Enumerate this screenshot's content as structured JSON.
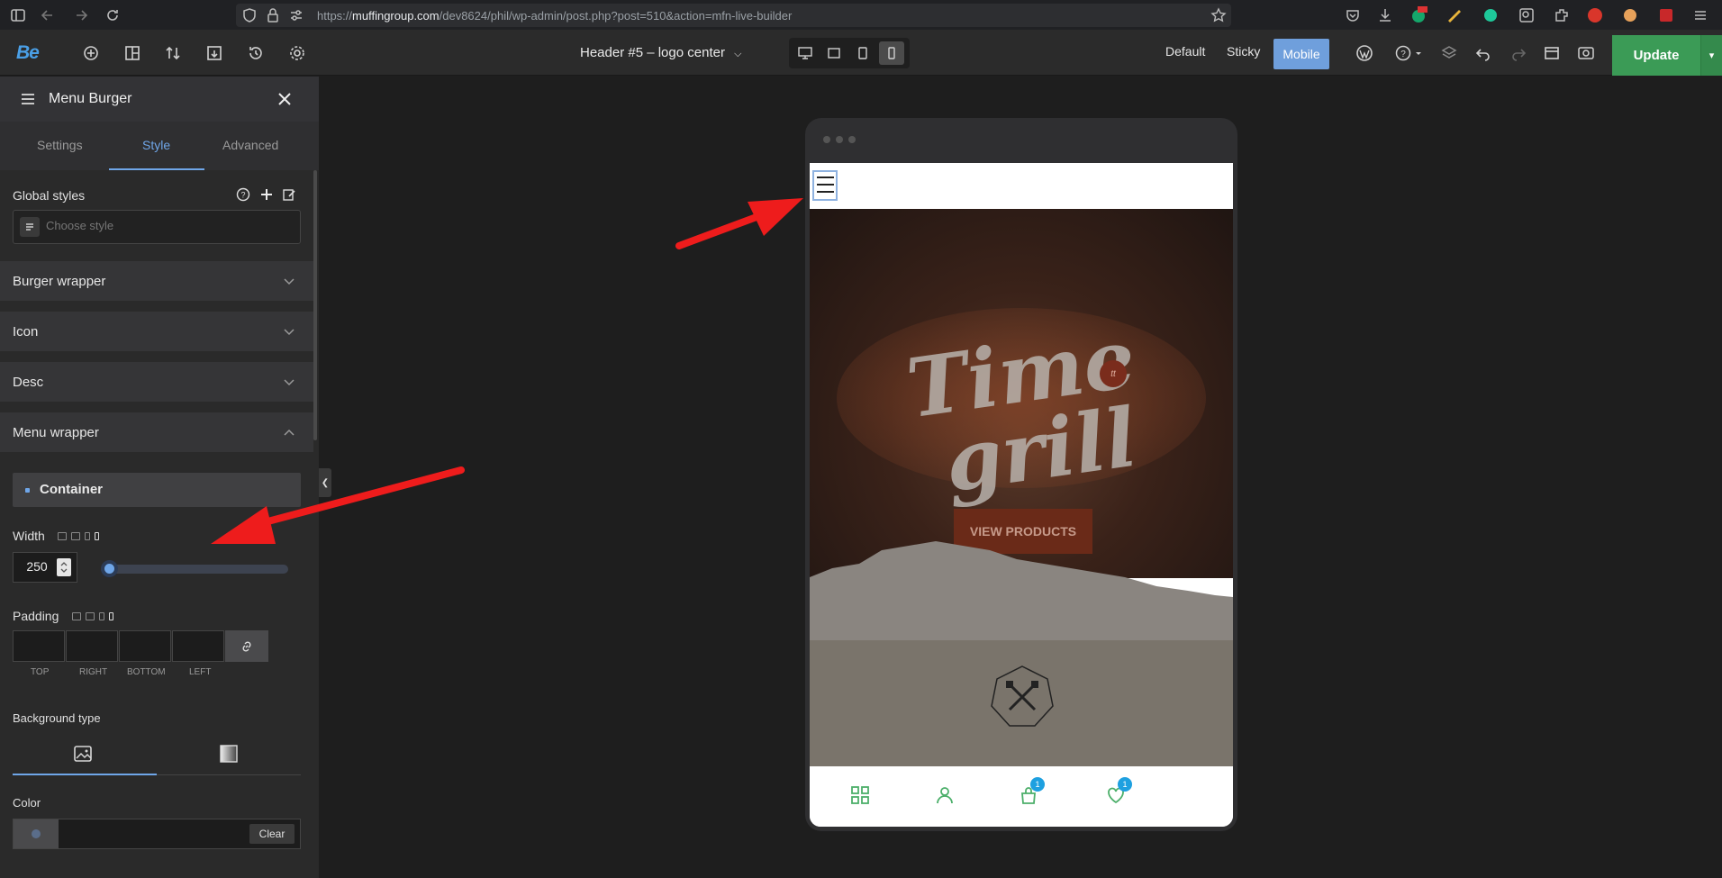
{
  "browser": {
    "url_prefix": "https://",
    "url_host": "muffingroup.com",
    "url_path": "/dev8624/phil/wp-admin/post.php?post=510&action=mfn-live-builder"
  },
  "toolbar": {
    "logo": "Be",
    "page_title": "Header #5 – logo center",
    "modes": {
      "default": "Default",
      "sticky": "Sticky",
      "mobile": "Mobile"
    },
    "update_label": "Update"
  },
  "panel": {
    "title": "Menu Burger",
    "tabs": [
      "Settings",
      "Style",
      "Advanced"
    ],
    "active_tab": "Style",
    "global_styles_label": "Global styles",
    "style_placeholder": "Choose style",
    "sections": [
      "Burger wrapper",
      "Icon",
      "Desc",
      "Menu wrapper"
    ],
    "container_label": "Container",
    "width_label": "Width",
    "width_value": "250",
    "width_slider_fraction": 0.0,
    "padding_label": "Padding",
    "padding_sides": [
      "TOP",
      "RIGHT",
      "BOTTOM",
      "LEFT"
    ],
    "background_type_label": "Background type",
    "color_label": "Color",
    "clear_label": "Clear"
  },
  "preview": {
    "hero_logo_line1": "Time",
    "hero_logo_line2": "grill",
    "hero_button": "VIEW PRODUCTS",
    "cart_count": "1",
    "wishlist_count": "1"
  },
  "colors": {
    "accent": "#6fa6e8",
    "update_green": "#3b9b56",
    "annotation_red": "#ee1c1c",
    "nav_green": "#4caf6a"
  }
}
